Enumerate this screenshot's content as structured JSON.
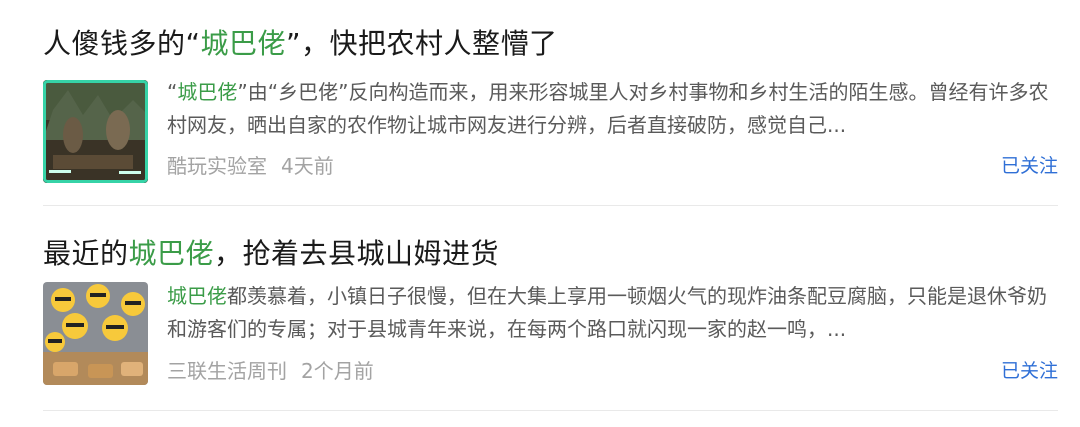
{
  "results": [
    {
      "title_pre": "人傻钱多的“",
      "title_hl": "城巴佬",
      "title_post": "”，快把农村人整懵了",
      "snippet_pre": "“",
      "snippet_hl": "城巴佬",
      "snippet_post": "”由“乡巴佬”反向构造而来，用来形容城里人对乡村事物和乡村生活的陌生感。曾经有许多农村网友，晒出自家的农作物让城市网友进行分辨，后者直接破防，感觉自己...",
      "source": "酷玩实验室",
      "time": "4天前",
      "follow_label": "已关注",
      "thumb_icon": "video-thumbnail-icon"
    },
    {
      "title_pre": "最近的",
      "title_hl": "城巴佬",
      "title_post": "，抢着去县城山姆进货",
      "snippet_pre": "",
      "snippet_hl": "城巴佬",
      "snippet_post": "都羡慕着，小镇日子很慢，但在大集上享用一顿烟火气的现炸油条配豆腐脑，只能是退休爷奶和游客们的专属；对于县城青年来说，在每两个路口就闪现一家的赵一鸣，...",
      "source": "三联生活周刊",
      "time": "2个月前",
      "follow_label": "已关注",
      "thumb_icon": "crowd-photo-icon"
    }
  ],
  "colors": {
    "highlight": "#3b9c48",
    "follow": "#2f6fd6",
    "meta": "#a3a3a3"
  }
}
